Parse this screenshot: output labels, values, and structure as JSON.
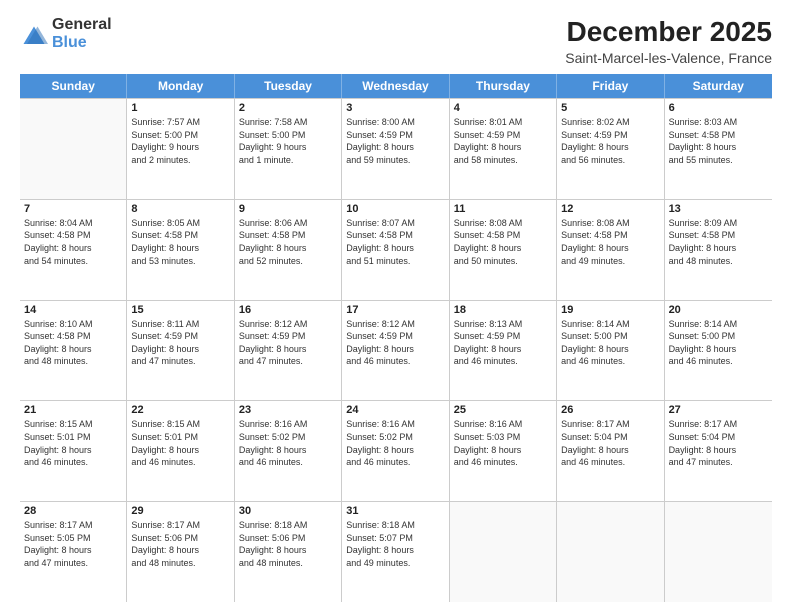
{
  "logo": {
    "general": "General",
    "blue": "Blue"
  },
  "title": "December 2025",
  "subtitle": "Saint-Marcel-les-Valence, France",
  "header_days": [
    "Sunday",
    "Monday",
    "Tuesday",
    "Wednesday",
    "Thursday",
    "Friday",
    "Saturday"
  ],
  "weeks": [
    [
      {
        "day": "",
        "info": ""
      },
      {
        "day": "1",
        "info": "Sunrise: 7:57 AM\nSunset: 5:00 PM\nDaylight: 9 hours\nand 2 minutes."
      },
      {
        "day": "2",
        "info": "Sunrise: 7:58 AM\nSunset: 5:00 PM\nDaylight: 9 hours\nand 1 minute."
      },
      {
        "day": "3",
        "info": "Sunrise: 8:00 AM\nSunset: 4:59 PM\nDaylight: 8 hours\nand 59 minutes."
      },
      {
        "day": "4",
        "info": "Sunrise: 8:01 AM\nSunset: 4:59 PM\nDaylight: 8 hours\nand 58 minutes."
      },
      {
        "day": "5",
        "info": "Sunrise: 8:02 AM\nSunset: 4:59 PM\nDaylight: 8 hours\nand 56 minutes."
      },
      {
        "day": "6",
        "info": "Sunrise: 8:03 AM\nSunset: 4:58 PM\nDaylight: 8 hours\nand 55 minutes."
      }
    ],
    [
      {
        "day": "7",
        "info": "Sunrise: 8:04 AM\nSunset: 4:58 PM\nDaylight: 8 hours\nand 54 minutes."
      },
      {
        "day": "8",
        "info": "Sunrise: 8:05 AM\nSunset: 4:58 PM\nDaylight: 8 hours\nand 53 minutes."
      },
      {
        "day": "9",
        "info": "Sunrise: 8:06 AM\nSunset: 4:58 PM\nDaylight: 8 hours\nand 52 minutes."
      },
      {
        "day": "10",
        "info": "Sunrise: 8:07 AM\nSunset: 4:58 PM\nDaylight: 8 hours\nand 51 minutes."
      },
      {
        "day": "11",
        "info": "Sunrise: 8:08 AM\nSunset: 4:58 PM\nDaylight: 8 hours\nand 50 minutes."
      },
      {
        "day": "12",
        "info": "Sunrise: 8:08 AM\nSunset: 4:58 PM\nDaylight: 8 hours\nand 49 minutes."
      },
      {
        "day": "13",
        "info": "Sunrise: 8:09 AM\nSunset: 4:58 PM\nDaylight: 8 hours\nand 48 minutes."
      }
    ],
    [
      {
        "day": "14",
        "info": "Sunrise: 8:10 AM\nSunset: 4:58 PM\nDaylight: 8 hours\nand 48 minutes."
      },
      {
        "day": "15",
        "info": "Sunrise: 8:11 AM\nSunset: 4:59 PM\nDaylight: 8 hours\nand 47 minutes."
      },
      {
        "day": "16",
        "info": "Sunrise: 8:12 AM\nSunset: 4:59 PM\nDaylight: 8 hours\nand 47 minutes."
      },
      {
        "day": "17",
        "info": "Sunrise: 8:12 AM\nSunset: 4:59 PM\nDaylight: 8 hours\nand 46 minutes."
      },
      {
        "day": "18",
        "info": "Sunrise: 8:13 AM\nSunset: 4:59 PM\nDaylight: 8 hours\nand 46 minutes."
      },
      {
        "day": "19",
        "info": "Sunrise: 8:14 AM\nSunset: 5:00 PM\nDaylight: 8 hours\nand 46 minutes."
      },
      {
        "day": "20",
        "info": "Sunrise: 8:14 AM\nSunset: 5:00 PM\nDaylight: 8 hours\nand 46 minutes."
      }
    ],
    [
      {
        "day": "21",
        "info": "Sunrise: 8:15 AM\nSunset: 5:01 PM\nDaylight: 8 hours\nand 46 minutes."
      },
      {
        "day": "22",
        "info": "Sunrise: 8:15 AM\nSunset: 5:01 PM\nDaylight: 8 hours\nand 46 minutes."
      },
      {
        "day": "23",
        "info": "Sunrise: 8:16 AM\nSunset: 5:02 PM\nDaylight: 8 hours\nand 46 minutes."
      },
      {
        "day": "24",
        "info": "Sunrise: 8:16 AM\nSunset: 5:02 PM\nDaylight: 8 hours\nand 46 minutes."
      },
      {
        "day": "25",
        "info": "Sunrise: 8:16 AM\nSunset: 5:03 PM\nDaylight: 8 hours\nand 46 minutes."
      },
      {
        "day": "26",
        "info": "Sunrise: 8:17 AM\nSunset: 5:04 PM\nDaylight: 8 hours\nand 46 minutes."
      },
      {
        "day": "27",
        "info": "Sunrise: 8:17 AM\nSunset: 5:04 PM\nDaylight: 8 hours\nand 47 minutes."
      }
    ],
    [
      {
        "day": "28",
        "info": "Sunrise: 8:17 AM\nSunset: 5:05 PM\nDaylight: 8 hours\nand 47 minutes."
      },
      {
        "day": "29",
        "info": "Sunrise: 8:17 AM\nSunset: 5:06 PM\nDaylight: 8 hours\nand 48 minutes."
      },
      {
        "day": "30",
        "info": "Sunrise: 8:18 AM\nSunset: 5:06 PM\nDaylight: 8 hours\nand 48 minutes."
      },
      {
        "day": "31",
        "info": "Sunrise: 8:18 AM\nSunset: 5:07 PM\nDaylight: 8 hours\nand 49 minutes."
      },
      {
        "day": "",
        "info": ""
      },
      {
        "day": "",
        "info": ""
      },
      {
        "day": "",
        "info": ""
      }
    ]
  ]
}
